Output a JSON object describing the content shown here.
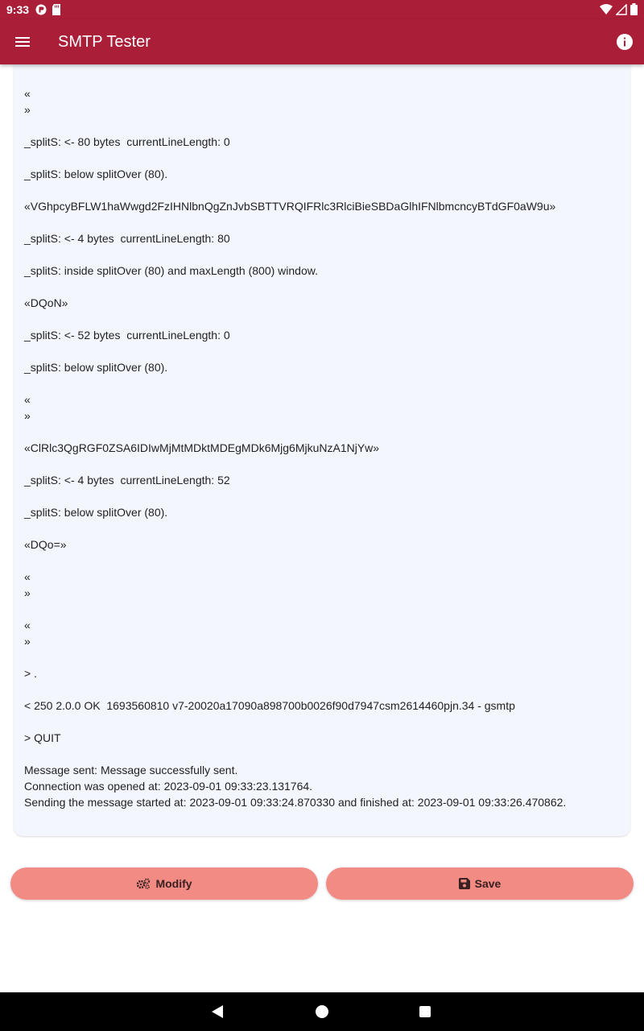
{
  "status_bar": {
    "time": "9:33"
  },
  "app_bar": {
    "title": "SMTP Tester"
  },
  "log": [
    "«\n»",
    "_splitS: <- 80 bytes  currentLineLength: 0",
    "_splitS: below splitOver (80).",
    "«VGhpcyBFLW1haWwgd2FzIHNlbnQgZnJvbSBTTVRQIFRlc3RlciBieSBDaGlhIFNlbmcncyBTdGF0aW9u»",
    "_splitS: <- 4 bytes  currentLineLength: 80",
    "_splitS: inside splitOver (80) and maxLength (800) window.",
    "«DQoN»",
    "_splitS: <- 52 bytes  currentLineLength: 0",
    "_splitS: below splitOver (80).",
    "«\n»",
    "«ClRlc3QgRGF0ZSA6IDIwMjMtMDktMDEgMDk6Mjg6MjkuNzA1NjYw»",
    "_splitS: <- 4 bytes  currentLineLength: 52",
    "_splitS: below splitOver (80).",
    "«DQo=»",
    "«\n»",
    "«\n»",
    "> .",
    "< 250 2.0.0 OK  1693560810 v7-20020a17090a898700b0026f90d7947csm2614460pjn.34 - gsmtp",
    "> QUIT",
    "Message sent: Message successfully sent.\nConnection was opened at: 2023-09-01 09:33:23.131764.\nSending the message started at: 2023-09-01 09:33:24.870330 and finished at: 2023-09-01 09:33:26.470862."
  ],
  "buttons": {
    "modify_label": "Modify",
    "save_label": "Save"
  },
  "colors": {
    "primary": "#ab1e38",
    "button": "#f28b84",
    "card": "#f3f7fd"
  }
}
